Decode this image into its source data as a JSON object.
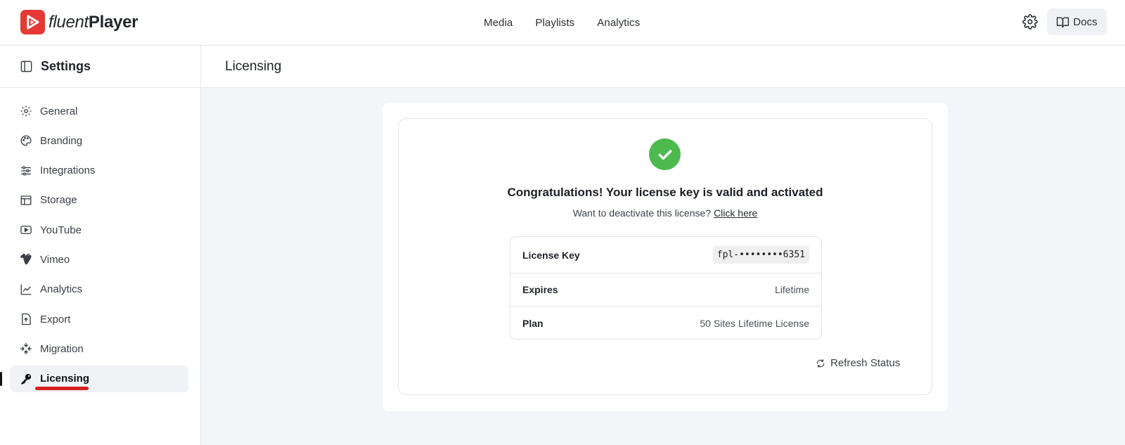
{
  "app": {
    "logo_light": "fluent",
    "logo_bold": "Player"
  },
  "topnav": {
    "items": [
      {
        "label": "Media"
      },
      {
        "label": "Playlists"
      },
      {
        "label": "Analytics"
      }
    ],
    "docs_label": "Docs"
  },
  "sidebar": {
    "title": "Settings",
    "items": [
      {
        "label": "General",
        "icon": "gear-icon"
      },
      {
        "label": "Branding",
        "icon": "palette-icon"
      },
      {
        "label": "Integrations",
        "icon": "sliders-icon"
      },
      {
        "label": "Storage",
        "icon": "storage-icon"
      },
      {
        "label": "YouTube",
        "icon": "youtube-icon"
      },
      {
        "label": "Vimeo",
        "icon": "vimeo-icon"
      },
      {
        "label": "Analytics",
        "icon": "chart-line-icon"
      },
      {
        "label": "Export",
        "icon": "export-icon"
      },
      {
        "label": "Migration",
        "icon": "migration-icon"
      },
      {
        "label": "Licensing",
        "icon": "key-icon",
        "active": true
      }
    ]
  },
  "page": {
    "title": "Licensing"
  },
  "license": {
    "congrats": "Congratulations! Your license key is valid and activated",
    "deactivate_prompt": "Want to deactivate this license?",
    "deactivate_link": "Click here",
    "rows": [
      {
        "label": "License Key",
        "value": "fpl-••••••••6351"
      },
      {
        "label": "Expires",
        "value": "Lifetime"
      },
      {
        "label": "Plan",
        "value": "50 Sites Lifetime License"
      }
    ],
    "refresh_label": "Refresh Status"
  },
  "colors": {
    "brand": "#e53935",
    "success": "#4cba4f",
    "highlight_underline": "#d61f1f"
  }
}
